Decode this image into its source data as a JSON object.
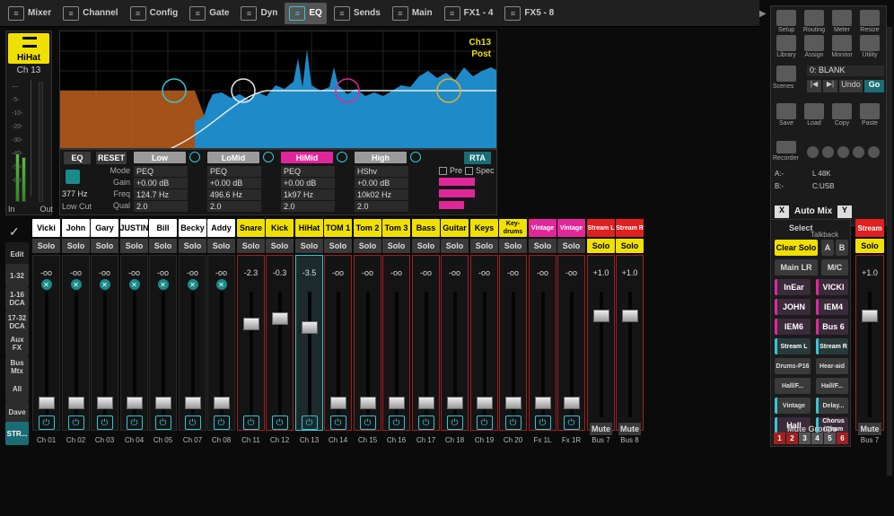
{
  "tabs": [
    {
      "label": "Mixer",
      "icon": "mixer-icon"
    },
    {
      "label": "Channel",
      "icon": "channel-icon"
    },
    {
      "label": "Config",
      "icon": "config-icon"
    },
    {
      "label": "Gate",
      "icon": "gate-icon"
    },
    {
      "label": "Dyn",
      "icon": "dyn-icon"
    },
    {
      "label": "EQ",
      "icon": "eq-icon"
    },
    {
      "label": "Sends",
      "icon": "sends-icon"
    },
    {
      "label": "Main",
      "icon": "main-icon"
    },
    {
      "label": "FX1 - 4",
      "icon": "fx-icon"
    },
    {
      "label": "FX5 - 8",
      "icon": "fx-icon"
    }
  ],
  "active_tab": "EQ",
  "selected_channel": {
    "name": "HiHat",
    "channel": "Ch 13",
    "in": "In",
    "out": "Out"
  },
  "eq": {
    "channel_label": "Ch13",
    "post_label": "Post",
    "eq_button": "EQ",
    "reset_button": "RESET",
    "row_labels": [
      "Mode",
      "Gain",
      "Freq",
      "Qual"
    ],
    "lowcut_freq": "377 Hz",
    "lowcut_label": "Low Cut",
    "bands": [
      {
        "name": "Low",
        "mode": "PEQ",
        "gain": "+0.00 dB",
        "freq": "124.7 Hz",
        "qual": "2.0",
        "color": "#9a9a9a"
      },
      {
        "name": "LoMid",
        "mode": "PEQ",
        "gain": "+0.00 dB",
        "freq": "496.6 Hz",
        "qual": "2.0",
        "color": "#9a9a9a"
      },
      {
        "name": "HiMid",
        "mode": "PEQ",
        "gain": "+0.00 dB",
        "freq": "1k97 Hz",
        "qual": "2.0",
        "color": "#e0279a"
      },
      {
        "name": "High",
        "mode": "HShv",
        "gain": "+0.00 dB",
        "freq": "10k02 Hz",
        "qual": "2.0",
        "color": "#9a9a9a"
      }
    ],
    "rta_button": "RTA",
    "pre_label": "Pre",
    "spec_label": "Spec"
  },
  "right_panel": {
    "icons": [
      {
        "label": "Setup",
        "name": "setup-icon"
      },
      {
        "label": "Routing",
        "name": "routing-icon"
      },
      {
        "label": "Meter",
        "name": "meter-icon"
      },
      {
        "label": "Resize",
        "name": "resize-icon"
      },
      {
        "label": "Library",
        "name": "library-icon"
      },
      {
        "label": "Assign",
        "name": "assign-icon"
      },
      {
        "label": "Monitor",
        "name": "monitor-icon"
      },
      {
        "label": "Utility",
        "name": "utility-icon"
      }
    ],
    "scenes_label": "Scenes",
    "scene_name": "0: BLANK",
    "undo": "Undo",
    "go": "Go",
    "file_icons": [
      {
        "label": "Save",
        "name": "save-icon"
      },
      {
        "label": "Load",
        "name": "load-icon"
      },
      {
        "label": "Copy",
        "name": "copy-icon"
      },
      {
        "label": "Paste",
        "name": "paste-icon"
      }
    ],
    "recorder_label": "Recorder",
    "a_label": "A:-",
    "b_label": "B:-",
    "sr_label": "L  48K",
    "card_label": "C:USB",
    "automix_x": "X",
    "automix_label": "Auto Mix",
    "automix_y": "Y"
  },
  "left_menu": [
    "Edit",
    "1-32",
    "1-16 DCA",
    "17-32 DCA",
    "Aux FX",
    "Bus Mtx",
    "All",
    "Dave",
    "STR..."
  ],
  "channels": [
    {
      "name": "Vicki",
      "color": "#ffffff",
      "db": "-oo",
      "label": "Ch 01",
      "fader": 0.1,
      "solo": false,
      "x": true
    },
    {
      "name": "John",
      "color": "#ffffff",
      "db": "-oo",
      "label": "Ch 02",
      "fader": 0.1,
      "solo": false,
      "x": true
    },
    {
      "name": "Gary",
      "color": "#ffffff",
      "db": "-oo",
      "label": "Ch 03",
      "fader": 0.1,
      "solo": false,
      "x": true
    },
    {
      "name": "JUSTIN",
      "color": "#ffffff",
      "db": "-oo",
      "label": "Ch 04",
      "fader": 0.1,
      "solo": false,
      "x": true
    },
    {
      "name": "Bill",
      "color": "#ffffff",
      "db": "-oo",
      "label": "Ch 05",
      "fader": 0.1,
      "solo": false,
      "x": true
    },
    {
      "name": "Becky",
      "color": "#ffffff",
      "db": "-oo",
      "label": "Ch 07",
      "fader": 0.1,
      "solo": false,
      "x": true
    },
    {
      "name": "Addy",
      "color": "#ffffff",
      "db": "-oo",
      "label": "Ch 08",
      "fader": 0.1,
      "solo": false,
      "x": true
    },
    {
      "name": "Snare",
      "color": "#f0e000",
      "db": "-2.3",
      "label": "Ch 11",
      "fader": 0.78,
      "solo": false,
      "x": false
    },
    {
      "name": "Kick",
      "color": "#f0e000",
      "db": "-0.3",
      "label": "Ch 12",
      "fader": 0.82,
      "solo": false,
      "x": false
    },
    {
      "name": "HiHat",
      "color": "#f0e000",
      "db": "-3.5",
      "label": "Ch 13",
      "fader": 0.75,
      "solo": false,
      "x": false,
      "selected": true
    },
    {
      "name": "TOM 1",
      "color": "#f0e000",
      "db": "-oo",
      "label": "Ch 14",
      "fader": 0.1,
      "solo": false,
      "x": false
    },
    {
      "name": "Tom 2",
      "color": "#f0e000",
      "db": "-oo",
      "label": "Ch 15",
      "fader": 0.1,
      "solo": false,
      "x": false
    },
    {
      "name": "Tom 3",
      "color": "#f0e000",
      "db": "-oo",
      "label": "Ch 16",
      "fader": 0.1,
      "solo": false,
      "x": false
    },
    {
      "name": "Bass",
      "color": "#f0e000",
      "db": "-oo",
      "label": "Ch 17",
      "fader": 0.1,
      "solo": false,
      "x": false
    },
    {
      "name": "Guitar",
      "color": "#f0e000",
      "db": "-oo",
      "label": "Ch 18",
      "fader": 0.1,
      "solo": false,
      "x": false
    },
    {
      "name": "Keys",
      "color": "#f0e000",
      "db": "-oo",
      "label": "Ch 19",
      "fader": 0.1,
      "solo": false,
      "x": false
    },
    {
      "name": "Key-drums",
      "color": "#f0e000",
      "db": "-oo",
      "label": "Ch 20",
      "fader": 0.1,
      "solo": false,
      "x": false
    },
    {
      "name": "Vintage",
      "color": "#e0279a",
      "db": "-oo",
      "label": "Fx 1L",
      "fader": 0.1,
      "solo": false,
      "x": false
    },
    {
      "name": "Vintage",
      "color": "#e0279a",
      "db": "-oo",
      "label": "Fx 1R",
      "fader": 0.1,
      "solo": false,
      "x": false
    },
    {
      "name": "Stream L",
      "color": "#e02020",
      "db": "+1.0",
      "label": "Bus 7",
      "fader": 0.85,
      "solo": true,
      "x": false,
      "mute": "Mute"
    },
    {
      "name": "Stream R",
      "color": "#e02020",
      "db": "+1.0",
      "label": "Bus 8",
      "fader": 0.85,
      "solo": true,
      "x": false,
      "mute": "Mute"
    }
  ],
  "solo_label": "Solo",
  "select_panel": {
    "title": "Select",
    "talkback": "Talkback",
    "clear_solo": "Clear Solo",
    "a": "A",
    "b": "B",
    "main_lr": "Main LR",
    "mc": "M/C",
    "buttons": [
      [
        "InEar",
        "VICKI"
      ],
      [
        "JOHN",
        "IEM4"
      ],
      [
        "IEM6",
        "Bus 6"
      ],
      [
        "Stream L",
        "Stream R"
      ],
      [
        "Drums-P16",
        "Hear-aid"
      ],
      [
        "Hall/F...",
        "Hall/F..."
      ],
      [
        "Vintage",
        "Delay..."
      ],
      [
        "Hall",
        "Chorus /Cham"
      ]
    ],
    "mute_groups_label": "Mute Groups",
    "mute_groups": [
      "1",
      "2",
      "3",
      "4",
      "5",
      "6"
    ]
  },
  "master": {
    "name": "Stream",
    "solo": "Solo",
    "db": "+1.0",
    "mute": "Mute",
    "label": "Bus 7"
  }
}
